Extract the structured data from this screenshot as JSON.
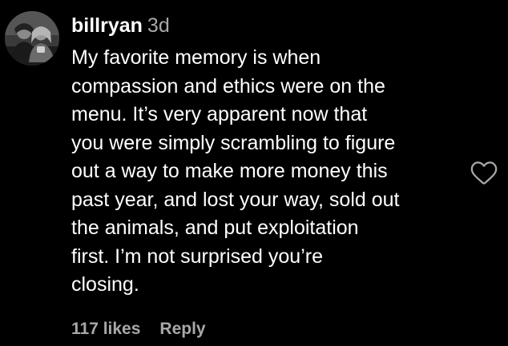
{
  "comment": {
    "username": "billryan",
    "timestamp": "3d",
    "text_lines": [
      "My favorite memory is when",
      "compassion and ethics were on the",
      "menu. It’s very apparent now that",
      "you were simply scrambling to figure",
      "out a way to make more money this",
      "past year, and lost your way, sold out",
      "the animals, and put exploitation",
      "first. I’m not surprised you’re",
      "closing."
    ],
    "likes": "117 likes",
    "reply_label": "Reply"
  },
  "icons": {
    "like": "heart-outline-icon",
    "avatar": "profile-photo"
  },
  "colors": {
    "background": "#000000",
    "primary_text": "#ffffff",
    "secondary_text": "#a8a8a8"
  }
}
